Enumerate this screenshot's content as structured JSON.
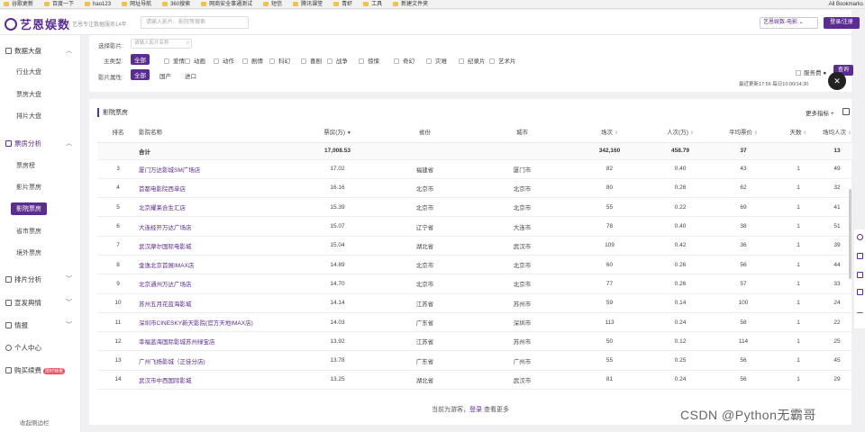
{
  "bookmarks": [
    "谷歌更新",
    "百度一下",
    "hao123",
    "网址导航",
    "360搜索",
    "网商安全事通测试",
    "短信",
    "腾讯课堂",
    "青虾",
    "工具",
    "新建文件夹"
  ],
  "bookmarks_all": "All Bookmarks",
  "header": {
    "logo": "艺恩娱数",
    "slogan": "艺恩专注数据服务14年",
    "search_placeholder": "请输入影片、影院等搜索",
    "brand_select": "艺恩娱数-电影",
    "login": "登录/注册"
  },
  "sidebar": {
    "sec1": "数据大盘",
    "sec1_items": [
      "行业大盘",
      "票房大盘",
      "排片大盘"
    ],
    "sec2": "票房分析",
    "sec2_items": [
      "票房榜",
      "影片票房",
      "影院票房",
      "省市票房",
      "境外票房"
    ],
    "sec3": "排片分析",
    "sec4": "宣发舆情",
    "sec5": "情报",
    "sec6": "个人中心",
    "sec7": "购买续费",
    "promo": "限时特惠",
    "collapse": "收起侧边栏"
  },
  "filters": {
    "film_label": "选择影片:",
    "film_placeholder": "请输入影片名称",
    "genre_label": "主类型:",
    "genres": [
      "全部",
      "爱情",
      "动画",
      "动作",
      "剧情",
      "科幻",
      "喜剧",
      "战争",
      "惊悚",
      "奇幻",
      "灾难",
      "纪录片",
      "艺术片"
    ],
    "attr_label": "影片属性:",
    "attrs": [
      "全部",
      "国产",
      "进口"
    ],
    "service_fee": "服务费",
    "query": "查询",
    "update": "最近更新17:56 每日10:00/14:30"
  },
  "panel": {
    "title": "影院票房",
    "more": "更多指标",
    "columns": [
      "排名",
      "影院名称",
      "票房(万)",
      "省份",
      "城市",
      "场次",
      "人次(万)",
      "平均票价",
      "天数",
      "场均人次"
    ],
    "total": [
      "",
      "合计",
      "17,008.53",
      "",
      "",
      "342,160",
      "458.79",
      "37",
      "",
      "13"
    ],
    "rows": [
      [
        "3",
        "厦门万达影城SM广场店",
        "17.02",
        "福建省",
        "厦门市",
        "82",
        "0.40",
        "43",
        "1",
        "49"
      ],
      [
        "4",
        "首都电影院西单店",
        "16.16",
        "北京市",
        "北京市",
        "80",
        "0.26",
        "62",
        "1",
        "32"
      ],
      [
        "5",
        "北京耀莱合生汇店",
        "15.39",
        "北京市",
        "北京市",
        "55",
        "0.22",
        "69",
        "1",
        "41"
      ],
      [
        "6",
        "大连经开万达广场店",
        "15.07",
        "辽宁省",
        "大连市",
        "78",
        "0.40",
        "38",
        "1",
        "51"
      ],
      [
        "7",
        "武汉摩尔国际电影城",
        "15.04",
        "湖北省",
        "武汉市",
        "109",
        "0.42",
        "36",
        "1",
        "39"
      ],
      [
        "8",
        "金逸北京首展IMAX店",
        "14.89",
        "北京市",
        "北京市",
        "60",
        "0.26",
        "56",
        "1",
        "44"
      ],
      [
        "9",
        "北京通州万达广场店",
        "14.70",
        "北京市",
        "北京市",
        "77",
        "0.26",
        "57",
        "1",
        "33"
      ],
      [
        "10",
        "苏州五月花蓝海影城",
        "14.14",
        "江苏省",
        "苏州市",
        "59",
        "0.14",
        "100",
        "1",
        "24"
      ],
      [
        "11",
        "深圳市CINESKY新天影院(官方天地IMAX店)",
        "14.03",
        "广东省",
        "深圳市",
        "113",
        "0.24",
        "58",
        "1",
        "22"
      ],
      [
        "12",
        "幸福蓝海国际影城苏州绿宝店",
        "13.92",
        "江苏省",
        "苏州市",
        "50",
        "0.12",
        "114",
        "1",
        "25"
      ],
      [
        "13",
        "广州飞扬影城（正佳分店)",
        "13.78",
        "广东省",
        "广州市",
        "55",
        "0.25",
        "56",
        "1",
        "45"
      ],
      [
        "14",
        "武汉市中西国际影城",
        "13.25",
        "湖北省",
        "武汉市",
        "81",
        "0.24",
        "56",
        "1",
        "29"
      ]
    ],
    "footer_pre": "当前为游客，",
    "footer_link": "登录",
    "footer_post": " 查看更多"
  },
  "watermark": "CSDN @Python无霸哥",
  "colors": {
    "accent": "#5b2d8e"
  }
}
